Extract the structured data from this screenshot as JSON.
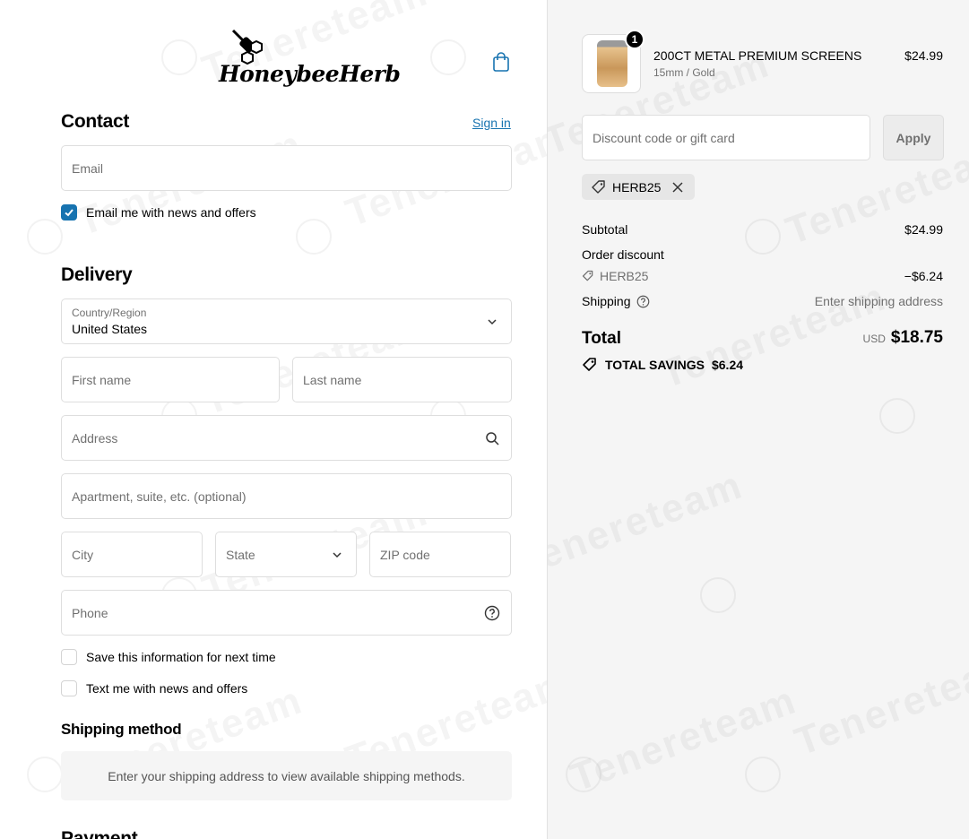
{
  "brand": {
    "logo_text": "HoneybeeHerb"
  },
  "watermark": {
    "text": "Tenereteam"
  },
  "contact": {
    "title": "Contact",
    "sign_in": "Sign in",
    "email_placeholder": "Email",
    "news_checkbox_label": "Email me with news and offers",
    "news_checked": true
  },
  "delivery": {
    "title": "Delivery",
    "country_label": "Country/Region",
    "country_value": "United States",
    "first_name_placeholder": "First name",
    "last_name_placeholder": "Last name",
    "address_placeholder": "Address",
    "apartment_placeholder": "Apartment, suite, etc. (optional)",
    "city_placeholder": "City",
    "state_placeholder": "State",
    "zip_placeholder": "ZIP code",
    "phone_placeholder": "Phone",
    "save_info_label": "Save this information for next time",
    "text_me_label": "Text me with news and offers"
  },
  "shipping_method": {
    "title": "Shipping method",
    "message": "Enter your shipping address to view available shipping methods."
  },
  "payment": {
    "title": "Payment"
  },
  "summary": {
    "product": {
      "name": "200CT METAL PREMIUM SCREENS",
      "variant": "15mm / Gold",
      "price": "$24.99",
      "quantity": "1"
    },
    "discount_placeholder": "Discount code or gift card",
    "apply_label": "Apply",
    "applied_code": "HERB25",
    "subtotal_label": "Subtotal",
    "subtotal_value": "$24.99",
    "order_discount_label": "Order discount",
    "order_discount_code": "HERB25",
    "order_discount_value": "−$6.24",
    "shipping_label": "Shipping",
    "shipping_value": "Enter shipping address",
    "total_label": "Total",
    "total_currency": "USD",
    "total_value": "$18.75",
    "savings_label": "TOTAL SAVINGS",
    "savings_value": "$6.24"
  },
  "colors": {
    "accent": "#1773b0",
    "summary_bg": "#f5f5f5"
  }
}
